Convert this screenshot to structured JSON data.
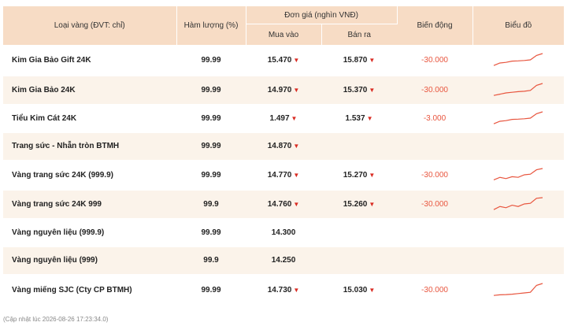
{
  "header": {
    "col_name": "Loại vàng (ĐVT: chỉ)",
    "col_purity": "Hàm lượng (%)",
    "col_price": "Đơn giá (nghìn VNĐ)",
    "col_buy": "Mua vào",
    "col_sell": "Bán ra",
    "col_change": "Biến động",
    "col_chart": "Biểu đồ"
  },
  "icons": {
    "down": "▼"
  },
  "colors": {
    "header_bg": "#f7dcc5",
    "alt_row": "#fbf3ea",
    "change": "#e8553e",
    "arrow": "#d92b22",
    "spark": "#e8553e"
  },
  "rows": [
    {
      "name": "Kim Gia Bảo Gift 24K",
      "purity": "99.99",
      "buy": "15.470",
      "buy_down": true,
      "sell": "15.870",
      "sell_down": true,
      "change": "-30.000",
      "spark": [
        0.05,
        0.25,
        0.3,
        0.4,
        0.42,
        0.45,
        0.5,
        0.85,
        1.0
      ]
    },
    {
      "name": "Kim Gia Bảo 24K",
      "purity": "99.99",
      "buy": "14.970",
      "buy_down": true,
      "sell": "15.370",
      "sell_down": true,
      "change": "-30.000",
      "spark": [
        0.05,
        0.15,
        0.25,
        0.3,
        0.35,
        0.38,
        0.45,
        0.85,
        1.0
      ]
    },
    {
      "name": "Tiểu Kim Cát 24K",
      "purity": "99.99",
      "buy": "1.497",
      "buy_down": true,
      "sell": "1.537",
      "sell_down": true,
      "change": "-3.000",
      "spark": [
        0.05,
        0.25,
        0.3,
        0.4,
        0.42,
        0.45,
        0.5,
        0.85,
        1.0
      ]
    },
    {
      "name": "Trang sức - Nhẫn tròn BTMH",
      "purity": "99.99",
      "buy": "14.870",
      "buy_down": true,
      "sell": "",
      "sell_down": false,
      "change": "",
      "spark": []
    },
    {
      "name": "Vàng trang sức 24K (999.9)",
      "purity": "99.99",
      "buy": "14.770",
      "buy_down": true,
      "sell": "15.270",
      "sell_down": true,
      "change": "-30.000",
      "spark": [
        0.1,
        0.3,
        0.2,
        0.35,
        0.3,
        0.5,
        0.55,
        0.9,
        1.0
      ]
    },
    {
      "name": "Vàng trang sức 24K 999",
      "purity": "99.9",
      "buy": "14.760",
      "buy_down": true,
      "sell": "15.260",
      "sell_down": true,
      "change": "-30.000",
      "spark": [
        0.05,
        0.3,
        0.2,
        0.4,
        0.3,
        0.5,
        0.55,
        0.95,
        1.0
      ]
    },
    {
      "name": "Vàng nguyên liệu (999.9)",
      "purity": "99.99",
      "buy": "14.300",
      "buy_down": false,
      "sell": "",
      "sell_down": false,
      "change": "",
      "spark": []
    },
    {
      "name": "Vàng nguyên liệu (999)",
      "purity": "99.9",
      "buy": "14.250",
      "buy_down": false,
      "sell": "",
      "sell_down": false,
      "change": "",
      "spark": []
    },
    {
      "name": "Vàng miếng SJC (Cty CP BTMH)",
      "purity": "99.99",
      "buy": "14.730",
      "buy_down": true,
      "sell": "15.030",
      "sell_down": true,
      "change": "-30.000",
      "spark": [
        0.05,
        0.1,
        0.12,
        0.15,
        0.2,
        0.25,
        0.3,
        0.85,
        1.0
      ]
    }
  ],
  "footer": {
    "updated": "(Cập nhật lúc 2026-08-26 17:23:34.0)"
  }
}
